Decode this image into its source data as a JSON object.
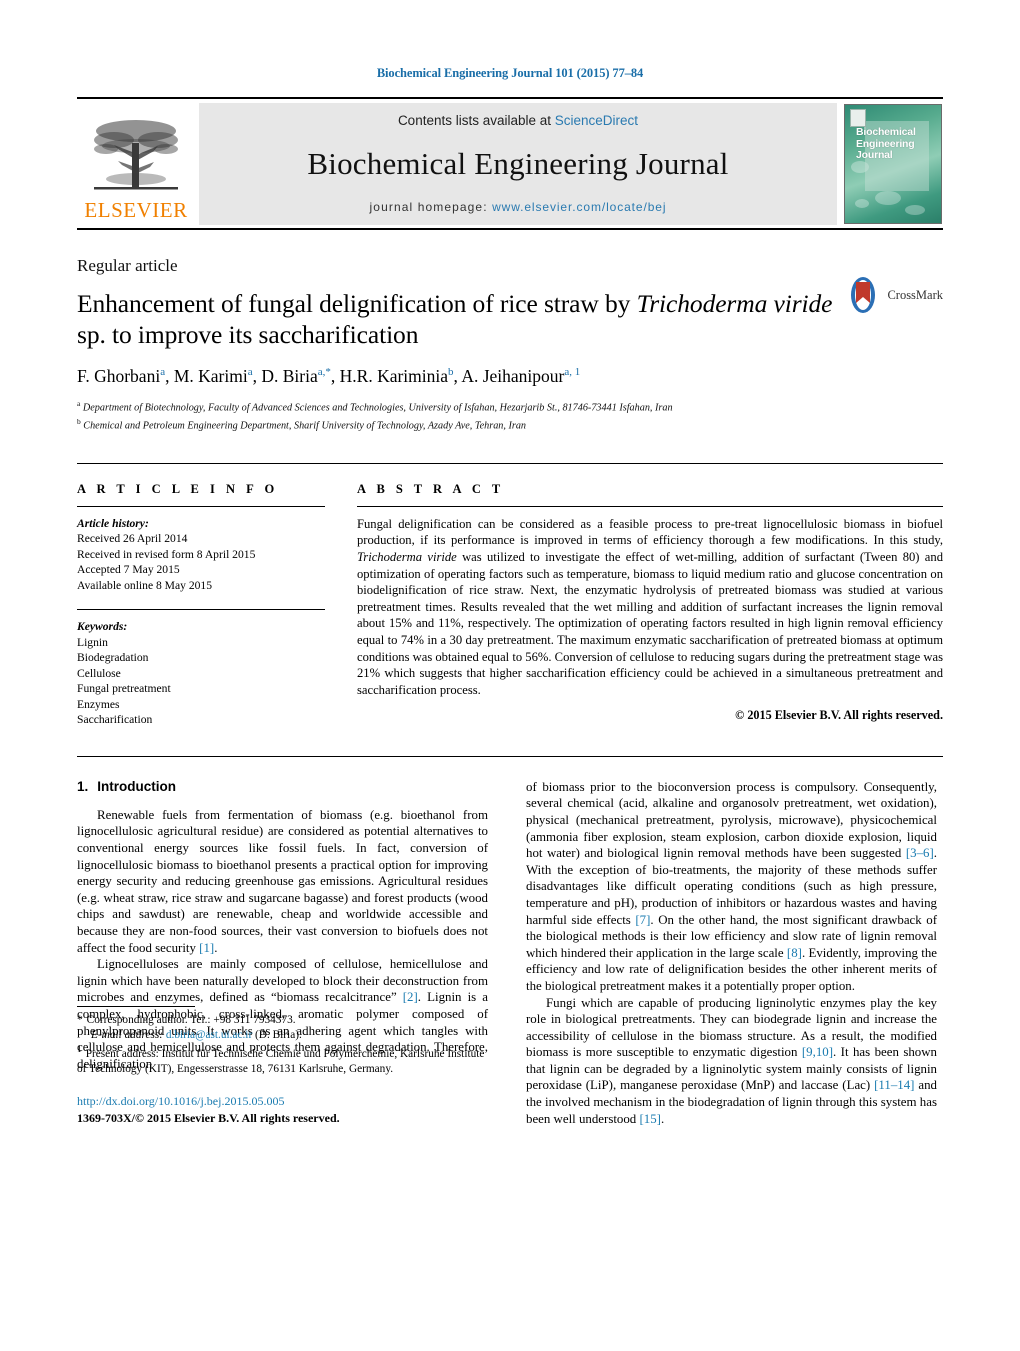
{
  "running_head": "Biochemical Engineering Journal 101 (2015) 77–84",
  "masthead": {
    "publisher_name": "ELSEVIER",
    "contents_prefix": "Contents lists available at ",
    "contents_link": "ScienceDirect",
    "journal_title": "Biochemical Engineering Journal",
    "homepage_label": "journal homepage:",
    "homepage_url": "www.elsevier.com/locate/bej",
    "cover_title_lines": [
      "Biochemical",
      "Engineering",
      "Journal"
    ]
  },
  "article": {
    "type_label": "Regular article",
    "title_part1": "Enhancement of fungal delignification of rice straw by ",
    "title_italic1": "Trichoderma",
    "title_italic2": "viride",
    "title_part2": " sp. to improve its saccharification",
    "crossmark_label": "CrossMark",
    "authors": [
      {
        "name": "F. Ghorbani",
        "sup": "a",
        "sep": ", "
      },
      {
        "name": "M. Karimi",
        "sup": "a",
        "sep": ", "
      },
      {
        "name": "D. Biria",
        "sup": "a,*",
        "sep": ", "
      },
      {
        "name": "H.R. Kariminia",
        "sup": "b",
        "sep": ", "
      },
      {
        "name": "A. Jeihanipour",
        "sup": "a, 1",
        "sep": ""
      }
    ],
    "affiliations": [
      {
        "marker": "a",
        "text": "Department of Biotechnology, Faculty of Advanced Sciences and Technologies, University of Isfahan, Hezarjarib St., 81746-73441 Isfahan, Iran"
      },
      {
        "marker": "b",
        "text": "Chemical and Petroleum Engineering Department, Sharif University of Technology, Azady Ave, Tehran, Iran"
      }
    ]
  },
  "article_info": {
    "heading": "A R T I C L E   I N F O",
    "history_title": "Article history:",
    "history": [
      "Received 26 April 2014",
      "Received in revised form 8 April 2015",
      "Accepted 7 May 2015",
      "Available online 8 May 2015"
    ],
    "keywords_title": "Keywords:",
    "keywords": [
      "Lignin",
      "Biodegradation",
      "Cellulose",
      "Fungal pretreatment",
      "Enzymes",
      "Saccharification"
    ]
  },
  "abstract": {
    "heading": "A B S T R A C T",
    "part1": "Fungal delignification can be considered as a feasible process to pre-treat lignocellulosic biomass in biofuel production, if its performance is improved in terms of efficiency thorough a few modifications. In this study, ",
    "species": "Trichoderma viride",
    "part2": " was utilized to investigate the effect of wet-milling, addition of surfactant (Tween 80) and optimization of operating factors such as temperature, biomass to liquid medium ratio and glucose concentration on biodelignification of rice straw. Next, the enzymatic hydrolysis of pretreated biomass was studied at various pretreatment times. Results revealed that the wet milling and addition of surfactant increases the lignin removal about 15% and 11%, respectively. The optimization of operating factors resulted in high lignin removal efficiency equal to 74% in a 30 day pretreatment. The maximum enzymatic saccharification of pretreated biomass at optimum conditions was obtained equal to 56%. Conversion of cellulose to reducing sugars during the pretreatment stage was 21% which suggests that higher saccharification efficiency could be achieved in a simultaneous pretreatment and saccharification process.",
    "copyright": "© 2015 Elsevier B.V. All rights reserved."
  },
  "introduction": {
    "heading_number": "1.",
    "heading_text": "Introduction",
    "p1_a": "Renewable fuels from fermentation of biomass (e.g. bioethanol from lignocellulosic agricultural residue) are considered as potential alternatives to conventional energy sources like fossil fuels. In fact, conversion of lignocellulosic biomass to bioethanol presents a practical option for improving energy security and reducing greenhouse gas emissions. Agricultural residues (e.g. wheat straw, rice straw and sugarcane bagasse) and forest products (wood chips and sawdust) are renewable, cheap and worldwide accessible and because they are non-food sources, their vast conversion to biofuels does not affect the food security ",
    "p1_ref": "[1]",
    "p1_b": ".",
    "p2_a": "Lignocelluloses are mainly composed of cellulose, hemicellulose and lignin which have been naturally developed to block their deconstruction from microbes and enzymes, defined as “biomass recalcitrance” ",
    "p2_ref": "[2]",
    "p2_b": ". Lignin is a complex, hydrophobic, cross-linked, aromatic polymer composed of phenylpropanoid units. It works as an adhering agent which tangles with cellulose and hemicellulose and protects them against degradation. Therefore, delignification",
    "r1_a": "of biomass prior to the bioconversion process is compulsory. Consequently, several chemical (acid, alkaline and organosolv pretreatment, wet oxidation), physical (mechanical pretreatment, pyrolysis, microwave), physicochemical (ammonia fiber explosion, steam explosion, carbon dioxide explosion, liquid hot water) and biological lignin removal methods have been suggested ",
    "r1_ref1": "[3–6]",
    "r1_b": ". With the exception of bio-treatments, the majority of these methods suffer disadvantages like difficult operating conditions (such as high pressure, temperature and pH), production of inhibitors or hazardous wastes and having harmful side effects ",
    "r1_ref2": "[7]",
    "r1_c": ". On the other hand, the most significant drawback of the biological methods is their low efficiency and slow rate of lignin removal which hindered their application in the large scale ",
    "r1_ref3": "[8]",
    "r1_d": ". Evidently, improving the efficiency and low rate of delignification besides the other inherent merits of the biological pretreatment makes it a potentially proper option.",
    "r2_a": "Fungi which are capable of producing ligninolytic enzymes play the key role in biological pretreatments. They can biodegrade lignin and increase the accessibility of cellulose in the biomass structure. As a result, the modified biomass is more susceptible to enzymatic digestion ",
    "r2_ref1": "[9,10]",
    "r2_b": ". It has been shown that lignin can be degraded by a ligninolytic system mainly consists of lignin peroxidase (LiP), manganese peroxidase (MnP) and laccase (Lac) ",
    "r2_ref2": "[11–14]",
    "r2_c": " and the involved mechanism in the biodegradation of lignin through this system has been well understood ",
    "r2_ref3": "[15]",
    "r2_d": "."
  },
  "footnotes": {
    "corresponding_marker": "*",
    "corresponding_text": "Corresponding author. Tel.: +98 311 7934373.",
    "email_label": "E-mail address:",
    "email": "d.biria@ast.ui.ac.ir",
    "email_owner": "(D. Biria).",
    "present_marker": "1",
    "present_text": "Present address: Institut für Technische Chemie und Polymerchemie, Karlsruhe Institute of Technology (KIT), Engesserstrasse 18, 76131 Karlsruhe, Germany.",
    "doi": "http://dx.doi.org/10.1016/j.bej.2015.05.005",
    "issn": "1369-703X/© 2015 Elsevier B.V. All rights reserved."
  },
  "colors": {
    "link": "#1a7bb0",
    "header_blue": "#1a6ea8",
    "elsevier_orange": "#F08000"
  }
}
